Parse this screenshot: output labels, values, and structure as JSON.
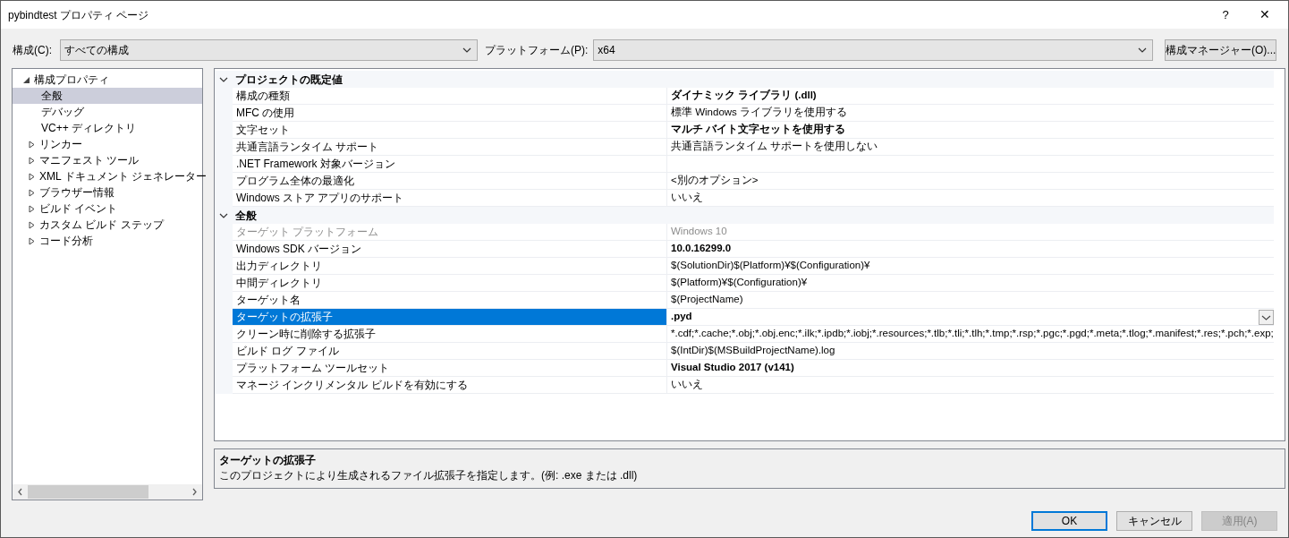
{
  "window": {
    "title": "pybindtest プロパティ ページ",
    "help": "?",
    "close": "✕"
  },
  "toolbar": {
    "config_label": "構成(C):",
    "config_value": "すべての構成",
    "platform_label": "プラットフォーム(P):",
    "platform_value": "x64",
    "manager_button": "構成マネージャー(O)..."
  },
  "tree": [
    {
      "label": "構成プロパティ",
      "kind": "group",
      "expanded": true,
      "selected": false,
      "children": [
        {
          "label": "全般",
          "kind": "leaf",
          "selected": true
        },
        {
          "label": "デバッグ",
          "kind": "leaf",
          "selected": false
        },
        {
          "label": "VC++ ディレクトリ",
          "kind": "leaf",
          "selected": false
        },
        {
          "label": "リンカー",
          "kind": "group",
          "expanded": false,
          "selected": false
        },
        {
          "label": "マニフェスト ツール",
          "kind": "group",
          "expanded": false,
          "selected": false
        },
        {
          "label": "XML ドキュメント ジェネレーター",
          "kind": "group",
          "expanded": false,
          "selected": false
        },
        {
          "label": "ブラウザー情報",
          "kind": "group",
          "expanded": false,
          "selected": false
        },
        {
          "label": "ビルド イベント",
          "kind": "group",
          "expanded": false,
          "selected": false
        },
        {
          "label": "カスタム ビルド ステップ",
          "kind": "group",
          "expanded": false,
          "selected": false
        },
        {
          "label": "コード分析",
          "kind": "group",
          "expanded": false,
          "selected": false
        }
      ]
    }
  ],
  "grid": [
    {
      "title": "プロジェクトの既定値",
      "expanded": true,
      "rows": [
        {
          "name": "構成の種類",
          "value": "ダイナミック ライブラリ (.dll)",
          "bold": true,
          "disabled": false,
          "selected": false
        },
        {
          "name": "MFC の使用",
          "value": "標準 Windows ライブラリを使用する",
          "bold": false,
          "disabled": false,
          "selected": false
        },
        {
          "name": "文字セット",
          "value": "マルチ バイト文字セットを使用する",
          "bold": true,
          "disabled": false,
          "selected": false
        },
        {
          "name": "共通言語ランタイム サポート",
          "value": "共通言語ランタイム サポートを使用しない",
          "bold": false,
          "disabled": false,
          "selected": false
        },
        {
          "name": ".NET Framework 対象バージョン",
          "disabled": false,
          "selected": false
        },
        {
          "name": "プログラム全体の最適化",
          "value": "<別のオプション>",
          "bold": false,
          "disabled": false,
          "selected": false
        },
        {
          "name": "Windows ストア アプリのサポート",
          "value": "いいえ",
          "bold": false,
          "disabled": false,
          "selected": false
        }
      ]
    },
    {
      "title": "全般",
      "expanded": true,
      "rows": [
        {
          "name": "ターゲット プラットフォーム",
          "value": "Windows 10",
          "bold": false,
          "disabled": true,
          "selected": false
        },
        {
          "name": "Windows SDK バージョン",
          "value": "10.0.16299.0",
          "bold": true,
          "disabled": false,
          "selected": false
        },
        {
          "name": "出力ディレクトリ",
          "value": "$(SolutionDir)$(Platform)¥$(Configuration)¥",
          "bold": false,
          "disabled": false,
          "selected": false
        },
        {
          "name": "中間ディレクトリ",
          "value": "$(Platform)¥$(Configuration)¥",
          "bold": false,
          "disabled": false,
          "selected": false
        },
        {
          "name": "ターゲット名",
          "value": "$(ProjectName)",
          "bold": false,
          "disabled": false,
          "selected": false
        },
        {
          "name": "ターゲットの拡張子",
          "value": ".pyd",
          "bold": true,
          "disabled": false,
          "selected": true
        },
        {
          "name": "クリーン時に削除する拡張子",
          "value": "*.cdf;*.cache;*.obj;*.obj.enc;*.ilk;*.ipdb;*.iobj;*.resources;*.tlb;*.tli;*.tlh;*.tmp;*.rsp;*.pgc;*.pgd;*.meta;*.tlog;*.manifest;*.res;*.pch;*.exp;",
          "bold": false,
          "disabled": false,
          "selected": false
        },
        {
          "name": "ビルド ログ ファイル",
          "value": "$(IntDir)$(MSBuildProjectName).log",
          "bold": false,
          "disabled": false,
          "selected": false
        },
        {
          "name": "プラットフォーム ツールセット",
          "value": "Visual Studio 2017 (v141)",
          "bold": true,
          "disabled": false,
          "selected": false
        },
        {
          "name": "マネージ インクリメンタル ビルドを有効にする",
          "value": "いいえ",
          "bold": false,
          "disabled": false,
          "selected": false
        }
      ]
    }
  ],
  "description": {
    "title": "ターゲットの拡張子",
    "text": "このプロジェクトにより生成されるファイル拡張子を指定します。(例: .exe または .dll)"
  },
  "buttons": [
    {
      "label": "OK",
      "disabled": false,
      "default": true
    },
    {
      "label": "キャンセル",
      "disabled": false,
      "default": false
    },
    {
      "label": "適用(A)",
      "disabled": true,
      "default": false
    }
  ]
}
